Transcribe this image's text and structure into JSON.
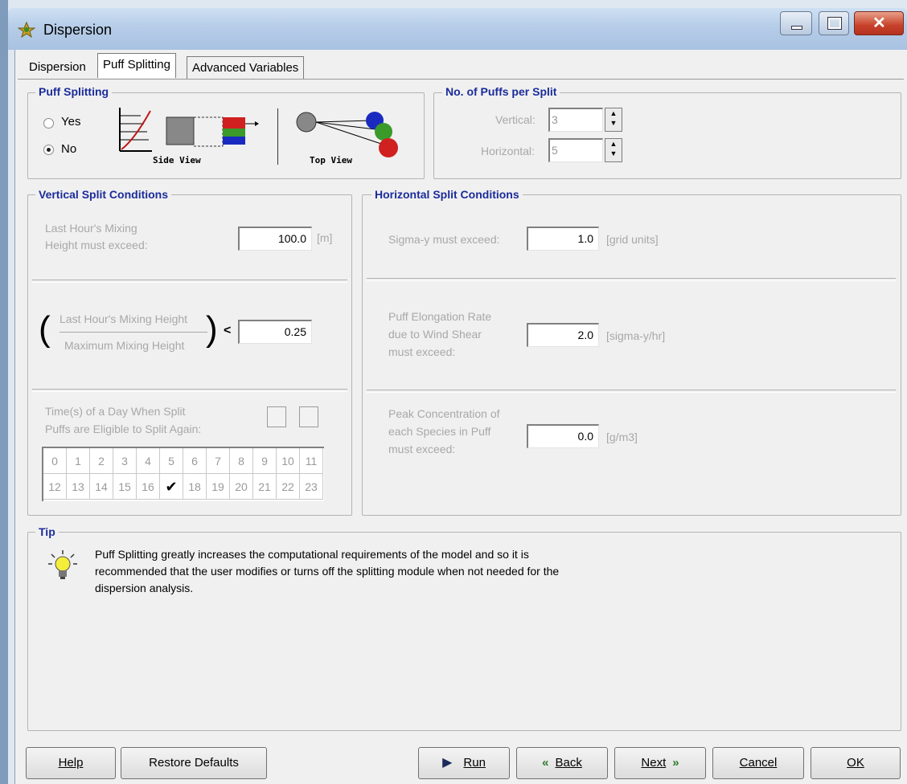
{
  "window": {
    "title": "Dispersion"
  },
  "tabs": [
    "Dispersion",
    "Puff Splitting",
    "Advanced Variables"
  ],
  "puff_splitting": {
    "title": "Puff Splitting",
    "yes_label": "Yes",
    "no_label": "No",
    "selected": "No",
    "side_view_label": "Side View",
    "top_view_label": "Top View"
  },
  "puffs_per_split": {
    "title": "No. of Puffs per Split",
    "vertical_label": "Vertical:",
    "vertical_value": "3",
    "horizontal_label": "Horizontal:",
    "horizontal_value": "5"
  },
  "vertical_split": {
    "title": "Vertical Split Conditions",
    "mixing_label_line1": "Last Hour's Mixing",
    "mixing_label_line2": "Height must exceed:",
    "mixing_value": "100.0",
    "mixing_unit": "[m]",
    "ratio_numerator": "Last Hour's Mixing Height",
    "ratio_denominator": "Maximum Mixing Height",
    "ratio_operator": "<",
    "ratio_value": "0.25",
    "times_label_line1": "Time(s) of a Day When Split",
    "times_label_line2": "Puffs are Eligible to Split Again:",
    "hours_row1": [
      "0",
      "1",
      "2",
      "3",
      "4",
      "5",
      "6",
      "7",
      "8",
      "9",
      "10",
      "11"
    ],
    "hours_row2": [
      "12",
      "13",
      "14",
      "15",
      "16",
      "",
      "18",
      "19",
      "20",
      "21",
      "22",
      "23"
    ],
    "checked_hour": "17"
  },
  "horizontal_split": {
    "title": "Horizontal Split Conditions",
    "sigma_label": "Sigma-y must exceed:",
    "sigma_value": "1.0",
    "sigma_unit": "[grid units]",
    "elong_label_line1": "Puff Elongation Rate",
    "elong_label_line2": "due to Wind Shear",
    "elong_label_line3": "must exceed:",
    "elong_value": "2.0",
    "elong_unit": "[sigma-y/hr]",
    "peak_label_line1": "Peak Concentration of",
    "peak_label_line2": "each Species in Puff",
    "peak_label_line3": "must exceed:",
    "peak_value": "0.0",
    "peak_unit": "[g/m3]"
  },
  "tip": {
    "title": "Tip",
    "line1": "Puff Splitting greatly increases the computational requirements of the model and so it is",
    "line2": "recommended that the user modifies or turns off the splitting module when not needed for the",
    "line3": "dispersion analysis.",
    "icon": "lightbulb-icon"
  },
  "buttons": {
    "help": "Help",
    "restore": "Restore Defaults",
    "run": "Run",
    "back": "Back",
    "next": "Next",
    "cancel": "Cancel",
    "ok": "OK"
  },
  "colors": {
    "group_title": "#1b2c9a",
    "close_button": "#c8412a"
  }
}
